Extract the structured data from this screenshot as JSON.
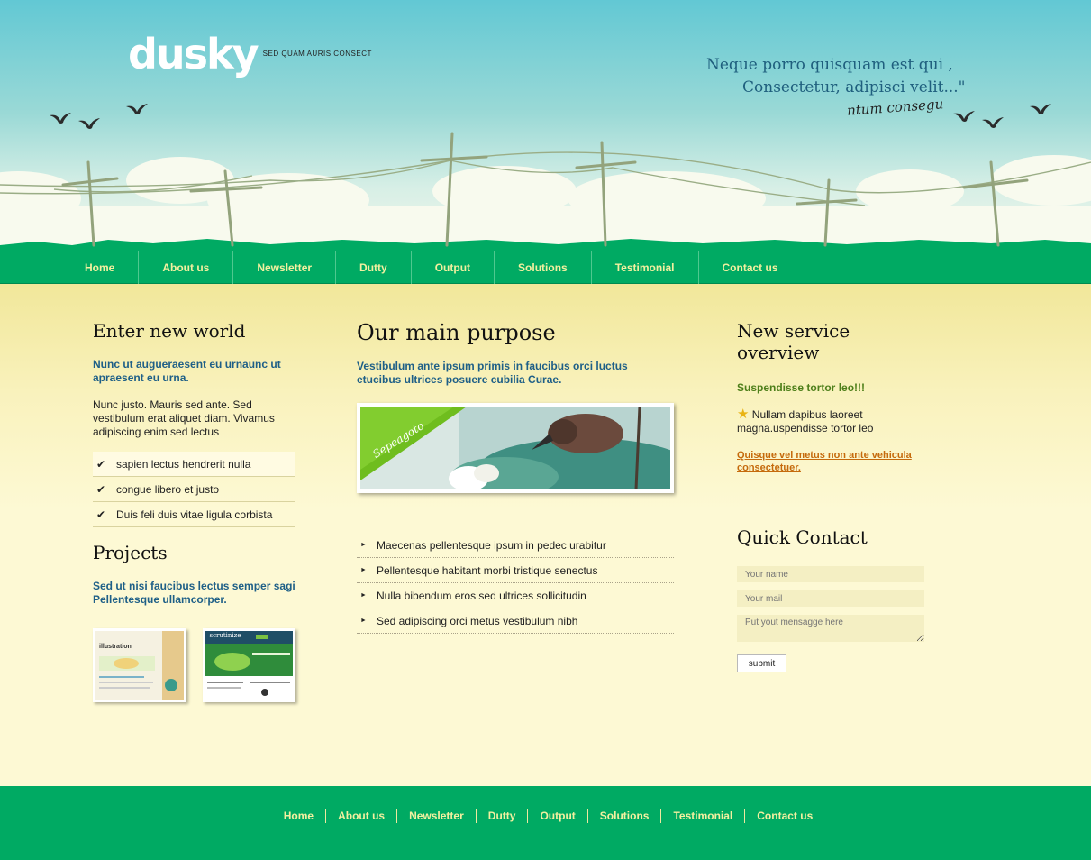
{
  "header": {
    "logo": "dusky",
    "tagline": "SED QUAM AURIS CONSECT",
    "quote_line1": "Neque porro quisquam est qui ,",
    "quote_line2": "Consectetur, adipisci velit...\"",
    "signature": "ntum consegu"
  },
  "nav": {
    "items": [
      "Home",
      "About us",
      "Newsletter",
      "Dutty",
      "Output",
      "Solutions",
      "Testimonial",
      "Contact us"
    ]
  },
  "left": {
    "title": "Enter new world",
    "lead": "Nunc ut augueraesent eu urnaunc ut apraesent eu urna.",
    "body": "Nunc justo. Mauris sed ante. Sed vestibulum erat aliquet diam. Vivamus adipiscing enim sed lectus",
    "checklist": [
      "sapien lectus hendrerit nulla",
      "congue libero et justo",
      "Duis feli duis vitae ligula corbista"
    ],
    "check_icon": "✔",
    "projects_title": "Projects",
    "projects_lead": "Sed ut nisi faucibus lectus semper sagi Pellentesque ullamcorper.",
    "thumb1_title": "illustration",
    "thumb2_title": "scrutinize"
  },
  "middle": {
    "title": "Our main purpose",
    "lead": "Vestibulum ante ipsum primis in faucibus orci luctus etucibus ultrices posuere cubilia Curae.",
    "feature_ribbon": "Sepeagoto",
    "list": [
      "Maecenas pellentesque ipsum in pedec urabitur",
      "Pellentesque habitant morbi tristique senectus",
      "Nulla bibendum eros sed ultrices sollicitudin",
      "Sed adipiscing orci metus vestibulum nibh"
    ],
    "arrow_icon": "►"
  },
  "right": {
    "title": "New service overview",
    "green_lead": "Suspendisse tortor leo!!!",
    "star_icon": "★",
    "star_text": "Nullam dapibus laoreet magna.uspendisse tortor leo",
    "link": "Quisque vel metus non ante vehicula consectetuer.",
    "contact_title": "Quick Contact",
    "name_placeholder": "Your name",
    "mail_placeholder": "Your mail",
    "message_placeholder": "Put yout mensagge here",
    "submit": "submit"
  },
  "footer": {
    "items": [
      "Home",
      "About us",
      "Newsletter",
      "Dutty",
      "Output",
      "Solutions",
      "Testimonial",
      "Contact us"
    ]
  },
  "colors": {
    "green": "#00aa63",
    "nav_text": "#f3f0a0",
    "lead_blue": "#1e5f87",
    "link_orange": "#c56a0c",
    "cream": "#fdf9d4"
  }
}
